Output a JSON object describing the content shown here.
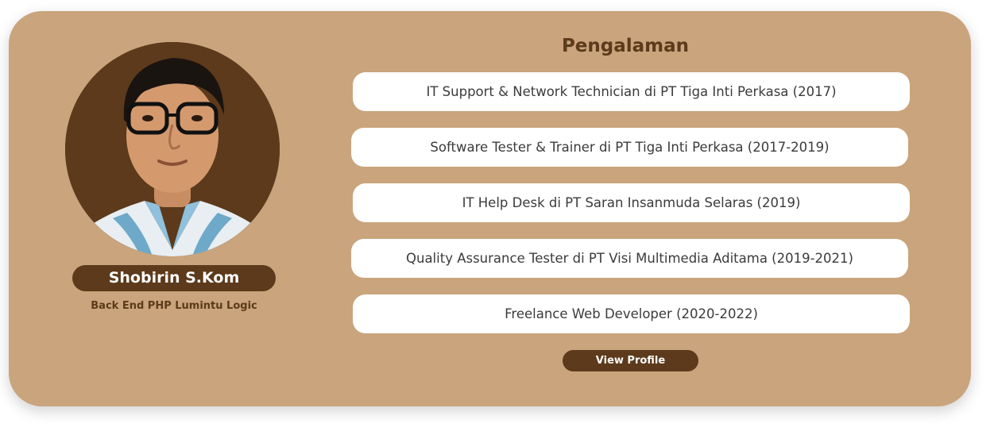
{
  "profile": {
    "name": "Shobirin S.Kom",
    "role": "Back End PHP Lumintu Logic"
  },
  "experience": {
    "title": "Pengalaman",
    "items": [
      "IT Support & Network Technician di PT Tiga Inti Perkasa (2017)",
      "Software Tester & Trainer di PT Tiga Inti Perkasa (2017-2019)",
      "IT Help Desk di PT Saran Insanmuda Selaras (2019)",
      "Quality Assurance Tester di PT Visi Multimedia Aditama (2019-2021)",
      "Freelance Web Developer (2020-2022)"
    ]
  },
  "actions": {
    "view_profile_label": "View Profile"
  },
  "colors": {
    "card_bg": "#c9a47c",
    "accent_brown": "#5c3a1b",
    "item_bg": "#ffffff"
  }
}
